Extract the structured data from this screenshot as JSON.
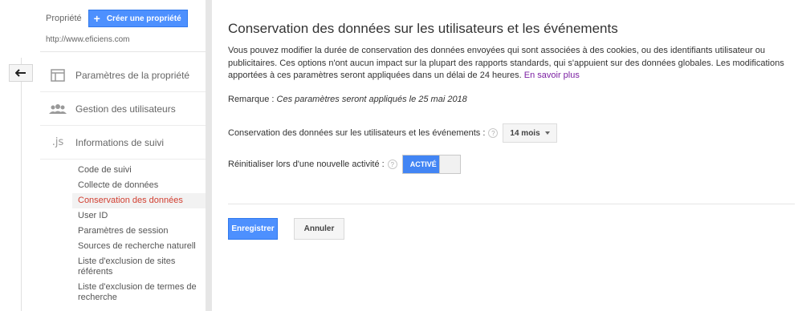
{
  "property": {
    "label": "Propriété",
    "create_button": "Créer une propriété",
    "url": "http://www.eficiens.com"
  },
  "nav": {
    "items": [
      {
        "label": "Paramètres de la propriété",
        "icon": "property-settings-icon"
      },
      {
        "label": "Gestion des utilisateurs",
        "icon": "users-icon"
      },
      {
        "label": "Informations de suivi",
        "icon": "js-icon",
        "icon_text": ".js"
      }
    ],
    "sub_items": [
      "Code de suivi",
      "Collecte de données",
      "Conservation des données",
      "User ID",
      "Paramètres de session",
      "Sources de recherche naturell",
      "Liste d'exclusion de sites référents",
      "Liste d'exclusion de termes de recherche"
    ],
    "active_sub_item": "Conservation des données"
  },
  "main": {
    "title": "Conservation des données sur les utilisateurs et les événements",
    "description": "Vous pouvez modifier la durée de conservation des données envoyées qui sont associées à des cookies, ou des identifiants utilisateur ou publicitaires. Ces options n'ont aucun impact sur la plupart des rapports standards, qui s'appuient sur des données globales. Les modifications apportées à ces paramètres seront appliquées dans un délai de 24 heures.",
    "learn_more": "En savoir plus",
    "note_label": "Remarque :",
    "note_text": "Ces paramètres seront appliqués le 25 mai 2018",
    "retention_label": "Conservation des données sur les utilisateurs et les événements :",
    "retention_value": "14 mois",
    "reset_label": "Réinitialiser lors d'une nouvelle activité :",
    "reset_toggle": "ACTIVÉ",
    "help_symbol": "?",
    "save_button": "Enregistrer",
    "cancel_button": "Annuler"
  },
  "colors": {
    "accent": "#4d90fe",
    "active_link": "#d23f31",
    "link": "#7b1fa2"
  }
}
